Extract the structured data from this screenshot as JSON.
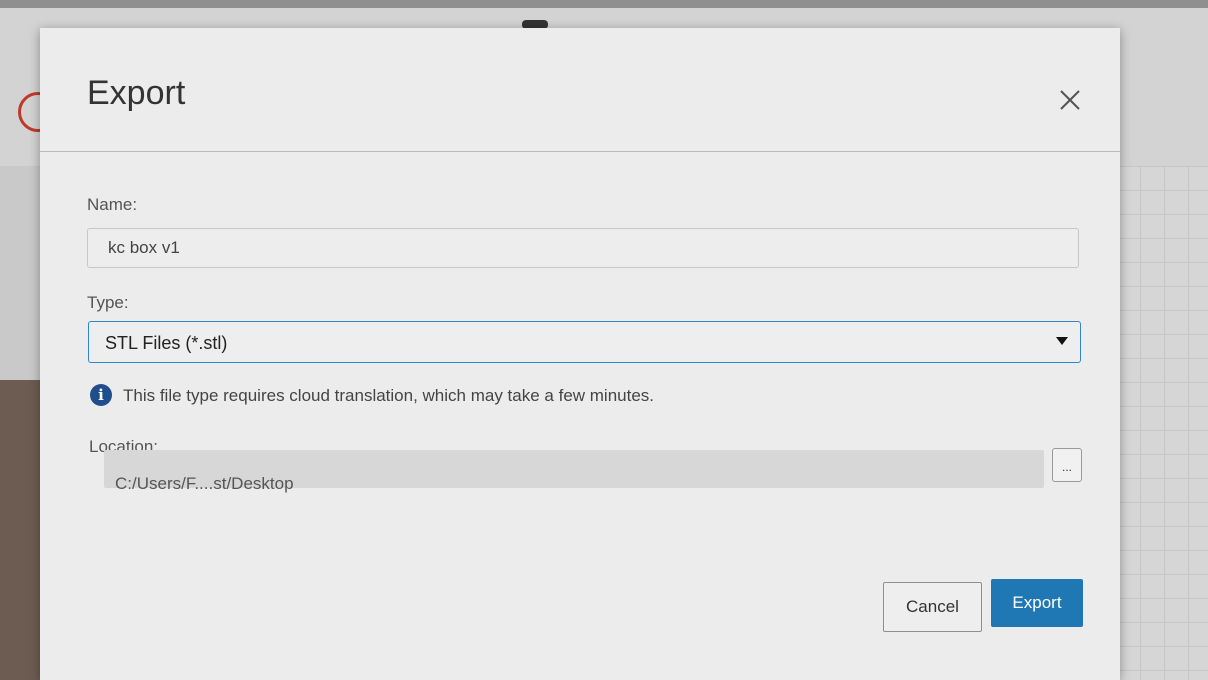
{
  "dialog": {
    "title": "Export",
    "close_icon": "close-icon"
  },
  "fields": {
    "name": {
      "label": "Name:",
      "value": "kc box v1"
    },
    "type": {
      "label": "Type:",
      "selected": "STL Files (*.stl)",
      "info_icon": "info-icon",
      "info_text": "This file type requires cloud translation, which may take a few minutes."
    },
    "location": {
      "label": "Location:",
      "value": "C:/Users/F....st/Desktop",
      "browse_label": "..."
    }
  },
  "buttons": {
    "cancel_label": "Cancel",
    "export_label": "Export"
  },
  "colors": {
    "primary": "#1f78b4",
    "focus_border": "#2f86c9",
    "info_icon": "#1f4e8c",
    "dialog_bg": "#ececec"
  }
}
